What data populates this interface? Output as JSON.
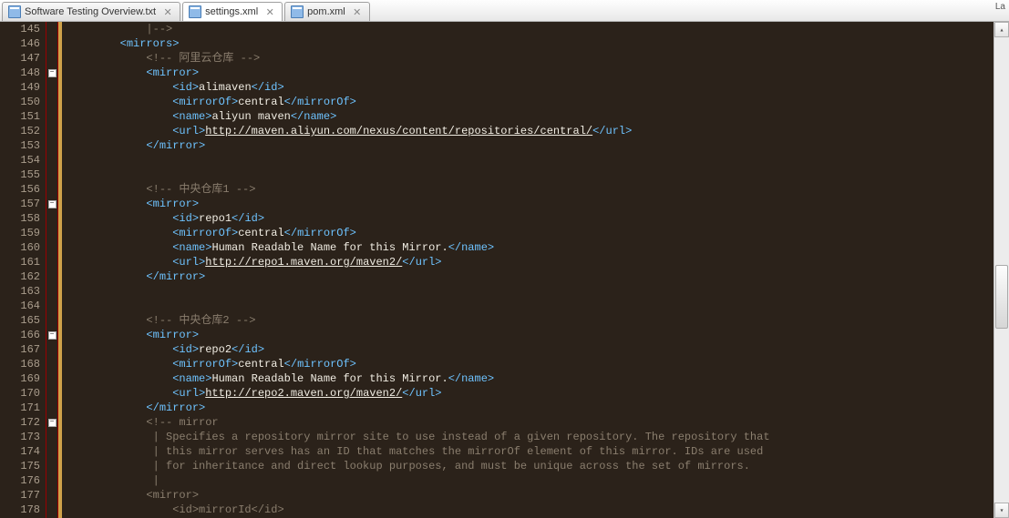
{
  "tabs": [
    {
      "label": "Software Testing Overview.txt",
      "active": false
    },
    {
      "label": "settings.xml",
      "active": true
    },
    {
      "label": "pom.xml",
      "active": false
    }
  ],
  "topRight": "La",
  "startLine": 145,
  "code": [
    {
      "n": 145,
      "fold": "",
      "t": "comment",
      "indent": 3,
      "text": "|-->"
    },
    {
      "n": 146,
      "fold": "",
      "t": "xml",
      "indent": 2,
      "raw": "<mirrors>"
    },
    {
      "n": 147,
      "fold": "",
      "t": "comment",
      "indent": 3,
      "text": "<!-- 阿里云仓库 -->"
    },
    {
      "n": 148,
      "fold": "minus",
      "t": "xml",
      "indent": 3,
      "raw": "<mirror>"
    },
    {
      "n": 149,
      "fold": "",
      "t": "elem",
      "indent": 4,
      "tag": "id",
      "val": "alimaven"
    },
    {
      "n": 150,
      "fold": "",
      "t": "elem",
      "indent": 4,
      "tag": "mirrorOf",
      "val": "central"
    },
    {
      "n": 151,
      "fold": "",
      "t": "elem",
      "indent": 4,
      "tag": "name",
      "val": "aliyun maven"
    },
    {
      "n": 152,
      "fold": "",
      "t": "url",
      "indent": 4,
      "tag": "url",
      "val": "http://maven.aliyun.com/nexus/content/repositories/central/"
    },
    {
      "n": 153,
      "fold": "",
      "t": "xml",
      "indent": 3,
      "raw": "</mirror>"
    },
    {
      "n": 154,
      "fold": "",
      "t": "blank",
      "indent": 0,
      "text": ""
    },
    {
      "n": 155,
      "fold": "",
      "t": "blank",
      "indent": 0,
      "text": ""
    },
    {
      "n": 156,
      "fold": "",
      "t": "comment",
      "indent": 3,
      "text": "<!-- 中央仓库1 -->"
    },
    {
      "n": 157,
      "fold": "minus",
      "t": "xml",
      "indent": 3,
      "raw": "<mirror>"
    },
    {
      "n": 158,
      "fold": "",
      "t": "elem",
      "indent": 4,
      "tag": "id",
      "val": "repo1"
    },
    {
      "n": 159,
      "fold": "",
      "t": "elem",
      "indent": 4,
      "tag": "mirrorOf",
      "val": "central"
    },
    {
      "n": 160,
      "fold": "",
      "t": "elem",
      "indent": 4,
      "tag": "name",
      "val": "Human Readable Name for this Mirror."
    },
    {
      "n": 161,
      "fold": "",
      "t": "url",
      "indent": 4,
      "tag": "url",
      "val": "http://repo1.maven.org/maven2/"
    },
    {
      "n": 162,
      "fold": "",
      "t": "xml",
      "indent": 3,
      "raw": "</mirror>"
    },
    {
      "n": 163,
      "fold": "",
      "t": "blank",
      "indent": 0,
      "text": ""
    },
    {
      "n": 164,
      "fold": "",
      "t": "blank",
      "indent": 0,
      "text": ""
    },
    {
      "n": 165,
      "fold": "",
      "t": "comment",
      "indent": 3,
      "text": "<!-- 中央仓库2 -->"
    },
    {
      "n": 166,
      "fold": "minus",
      "t": "xml",
      "indent": 3,
      "raw": "<mirror>"
    },
    {
      "n": 167,
      "fold": "",
      "t": "elem",
      "indent": 4,
      "tag": "id",
      "val": "repo2"
    },
    {
      "n": 168,
      "fold": "",
      "t": "elem",
      "indent": 4,
      "tag": "mirrorOf",
      "val": "central"
    },
    {
      "n": 169,
      "fold": "",
      "t": "elem",
      "indent": 4,
      "tag": "name",
      "val": "Human Readable Name for this Mirror."
    },
    {
      "n": 170,
      "fold": "",
      "t": "url",
      "indent": 4,
      "tag": "url",
      "val": "http://repo2.maven.org/maven2/"
    },
    {
      "n": 171,
      "fold": "",
      "t": "xml",
      "indent": 3,
      "raw": "</mirror>"
    },
    {
      "n": 172,
      "fold": "minus",
      "t": "comment",
      "indent": 3,
      "text": "<!-- mirror"
    },
    {
      "n": 173,
      "fold": "",
      "t": "comment",
      "indent": 3,
      "text": " | Specifies a repository mirror site to use instead of a given repository. The repository that"
    },
    {
      "n": 174,
      "fold": "",
      "t": "comment",
      "indent": 3,
      "text": " | this mirror serves has an ID that matches the mirrorOf element of this mirror. IDs are used"
    },
    {
      "n": 175,
      "fold": "",
      "t": "comment",
      "indent": 3,
      "text": " | for inheritance and direct lookup purposes, and must be unique across the set of mirrors."
    },
    {
      "n": 176,
      "fold": "",
      "t": "comment",
      "indent": 3,
      "text": " |"
    },
    {
      "n": 177,
      "fold": "",
      "t": "comment",
      "indent": 3,
      "text": "<mirror>"
    },
    {
      "n": 178,
      "fold": "",
      "t": "comment",
      "indent": 4,
      "text": "<id>mirrorId</id>"
    }
  ]
}
